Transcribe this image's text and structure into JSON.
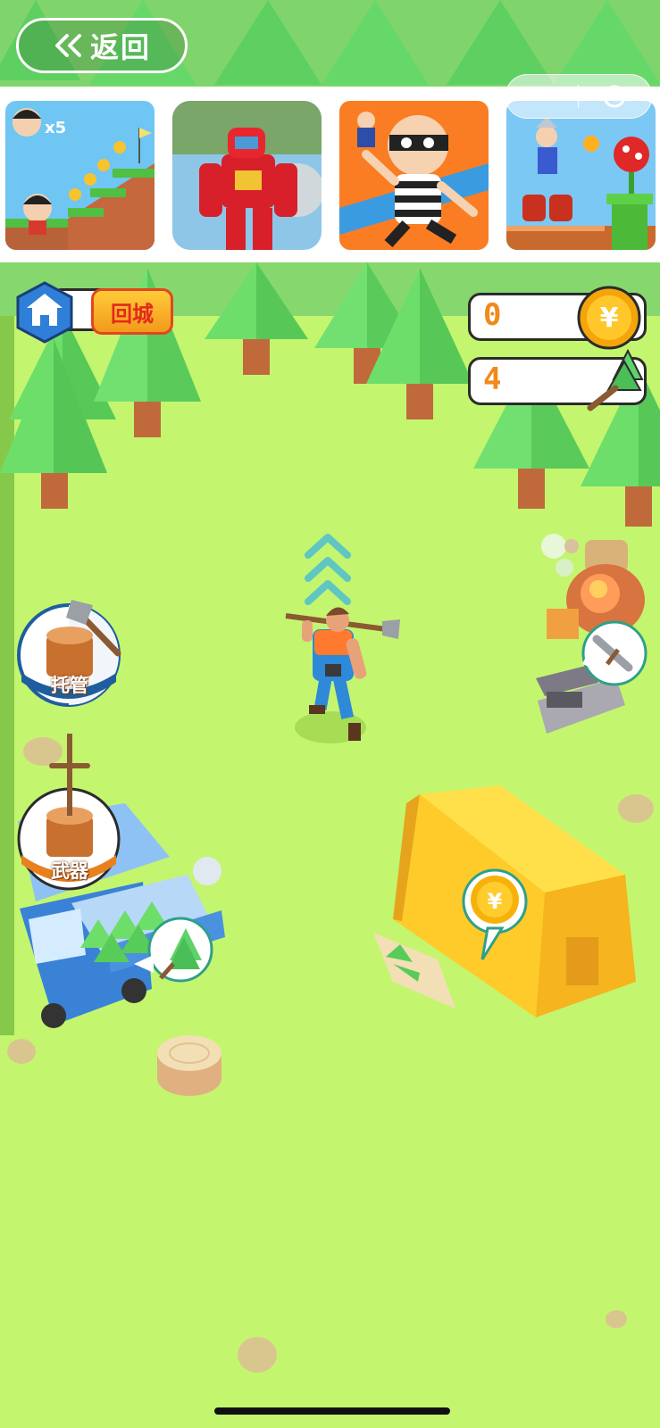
{
  "back_button": {
    "label": "返回"
  },
  "ad_strip": {
    "items": [
      {
        "name": "platformer-girl-game",
        "lives_text": "x5"
      },
      {
        "name": "robot-game"
      },
      {
        "name": "thief-game"
      },
      {
        "name": "hero-platformer-game"
      }
    ]
  },
  "hud": {
    "city_button_label": "回城",
    "coins": "0",
    "wood": "4"
  },
  "side_buttons": {
    "auto_label": "托管",
    "weapon_label": "武器"
  },
  "icons": {
    "back": "double-chevron-left-icon",
    "home": "house-icon",
    "coin": "yuan-coin-icon",
    "wood": "tree-icon",
    "sword": "sword-icon",
    "more": "three-dots-icon",
    "close": "target-circle-icon"
  },
  "colors": {
    "grass": "#c4f56f",
    "tree": "#6ede6a",
    "coin": "#f7b20a",
    "counter_text": "#f08a1a",
    "tent": "#ffd23a"
  }
}
